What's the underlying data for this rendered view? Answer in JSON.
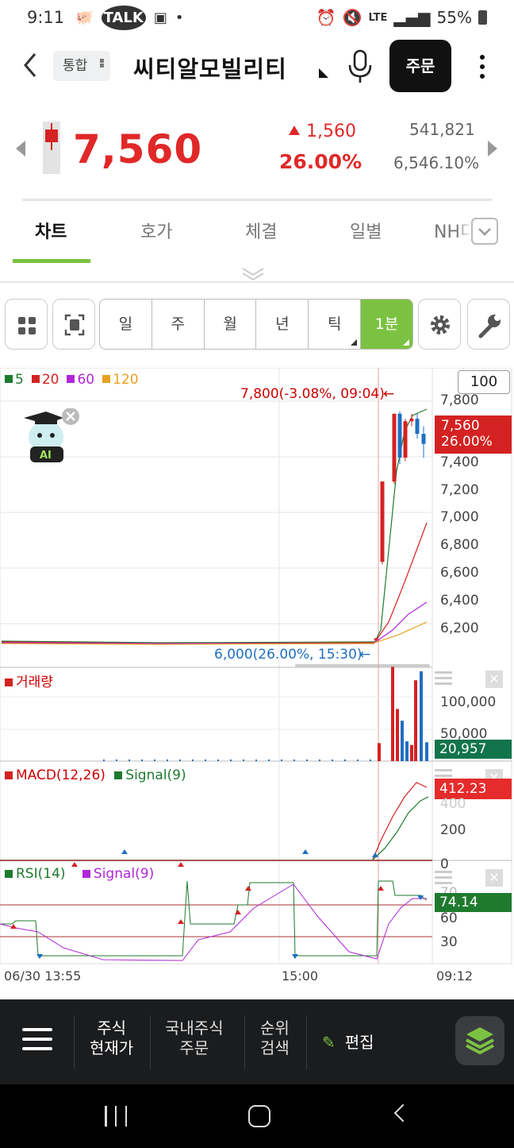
{
  "statusbar": {
    "time": "9:11",
    "talk": "TALK",
    "network": "LTE",
    "battery": "55%"
  },
  "header": {
    "scope_label": "통합",
    "stock_name": "씨티알모빌리티",
    "order_label": "주문"
  },
  "quote": {
    "price": "7,560",
    "change": "1,560",
    "change_pct": "26.00%",
    "volume": "541,821",
    "volume_pct": "6,546.10%"
  },
  "tabs": [
    {
      "label": "차트",
      "active": true
    },
    {
      "label": "호가",
      "active": false
    },
    {
      "label": "체결",
      "active": false
    },
    {
      "label": "일별",
      "active": false
    },
    {
      "label": "NH디",
      "active": false
    }
  ],
  "periods": [
    {
      "label": "일"
    },
    {
      "label": "주"
    },
    {
      "label": "월"
    },
    {
      "label": "년"
    },
    {
      "label": "틱"
    },
    {
      "label": "1분"
    }
  ],
  "chart": {
    "legend": [
      {
        "label": "5",
        "color": "#1f7a2e"
      },
      {
        "label": "20",
        "color": "#d42222"
      },
      {
        "label": "60",
        "color": "#b026d8"
      },
      {
        "label": "120",
        "color": "#e8a020"
      }
    ],
    "zoom": "100",
    "ai_label": "AI",
    "high_annotation": "7,800(-3.08%, 09:04)",
    "low_annotation": "6,000(26.00%, 15:30)",
    "current_price_tag": "7,560",
    "current_pct_tag": "26.00%",
    "price_ticks": [
      "7,800",
      "7,400",
      "7,200",
      "7,000",
      "6,800",
      "6,600",
      "6,400",
      "6,200"
    ],
    "volume_title": "거래량",
    "volume_ticks": [
      "100,000",
      "50,000"
    ],
    "volume_tag": "20,957",
    "macd_title": "MACD(12,26)",
    "macd_signal_title": "Signal(9)",
    "macd_ticks": [
      "400",
      "200",
      "0"
    ],
    "macd_tag": "412.23",
    "rsi_title": "RSI(14)",
    "rsi_signal_title": "Signal(9)",
    "rsi_ticks": [
      "70",
      "60",
      "30"
    ],
    "rsi_tag": "74.14",
    "x_labels": [
      "06/30 13:55",
      "15:00",
      "09:12"
    ]
  },
  "chart_data": {
    "type": "candlestick",
    "yrange": [
      6000,
      7900
    ],
    "candles": [
      {
        "o": 6000,
        "h": 6000,
        "l": 6000,
        "c": 6010
      },
      {
        "o": 6620,
        "h": 7260,
        "l": 6600,
        "c": 7260
      },
      {
        "o": 7260,
        "h": 7800,
        "l": 7240,
        "c": 7800
      },
      {
        "o": 7800,
        "h": 7820,
        "l": 7400,
        "c": 7450
      },
      {
        "o": 7450,
        "h": 7760,
        "l": 7420,
        "c": 7740
      },
      {
        "o": 7740,
        "h": 7800,
        "l": 7700,
        "c": 7760
      },
      {
        "o": 7760,
        "h": 7800,
        "l": 7600,
        "c": 7640
      },
      {
        "o": 7640,
        "h": 7700,
        "l": 7450,
        "c": 7560
      }
    ],
    "volume": [
      20000,
      105000,
      58000,
      45000,
      22000,
      18000,
      90000,
      100000,
      20957
    ],
    "volume_up": [
      true,
      true,
      true,
      false,
      false,
      true,
      true,
      false,
      false
    ]
  },
  "bottomnav": {
    "item1": [
      "주식",
      "현재가"
    ],
    "item2": [
      "국내주식",
      "주문"
    ],
    "item3": [
      "순위",
      "검색"
    ],
    "edit_label": "편집"
  }
}
